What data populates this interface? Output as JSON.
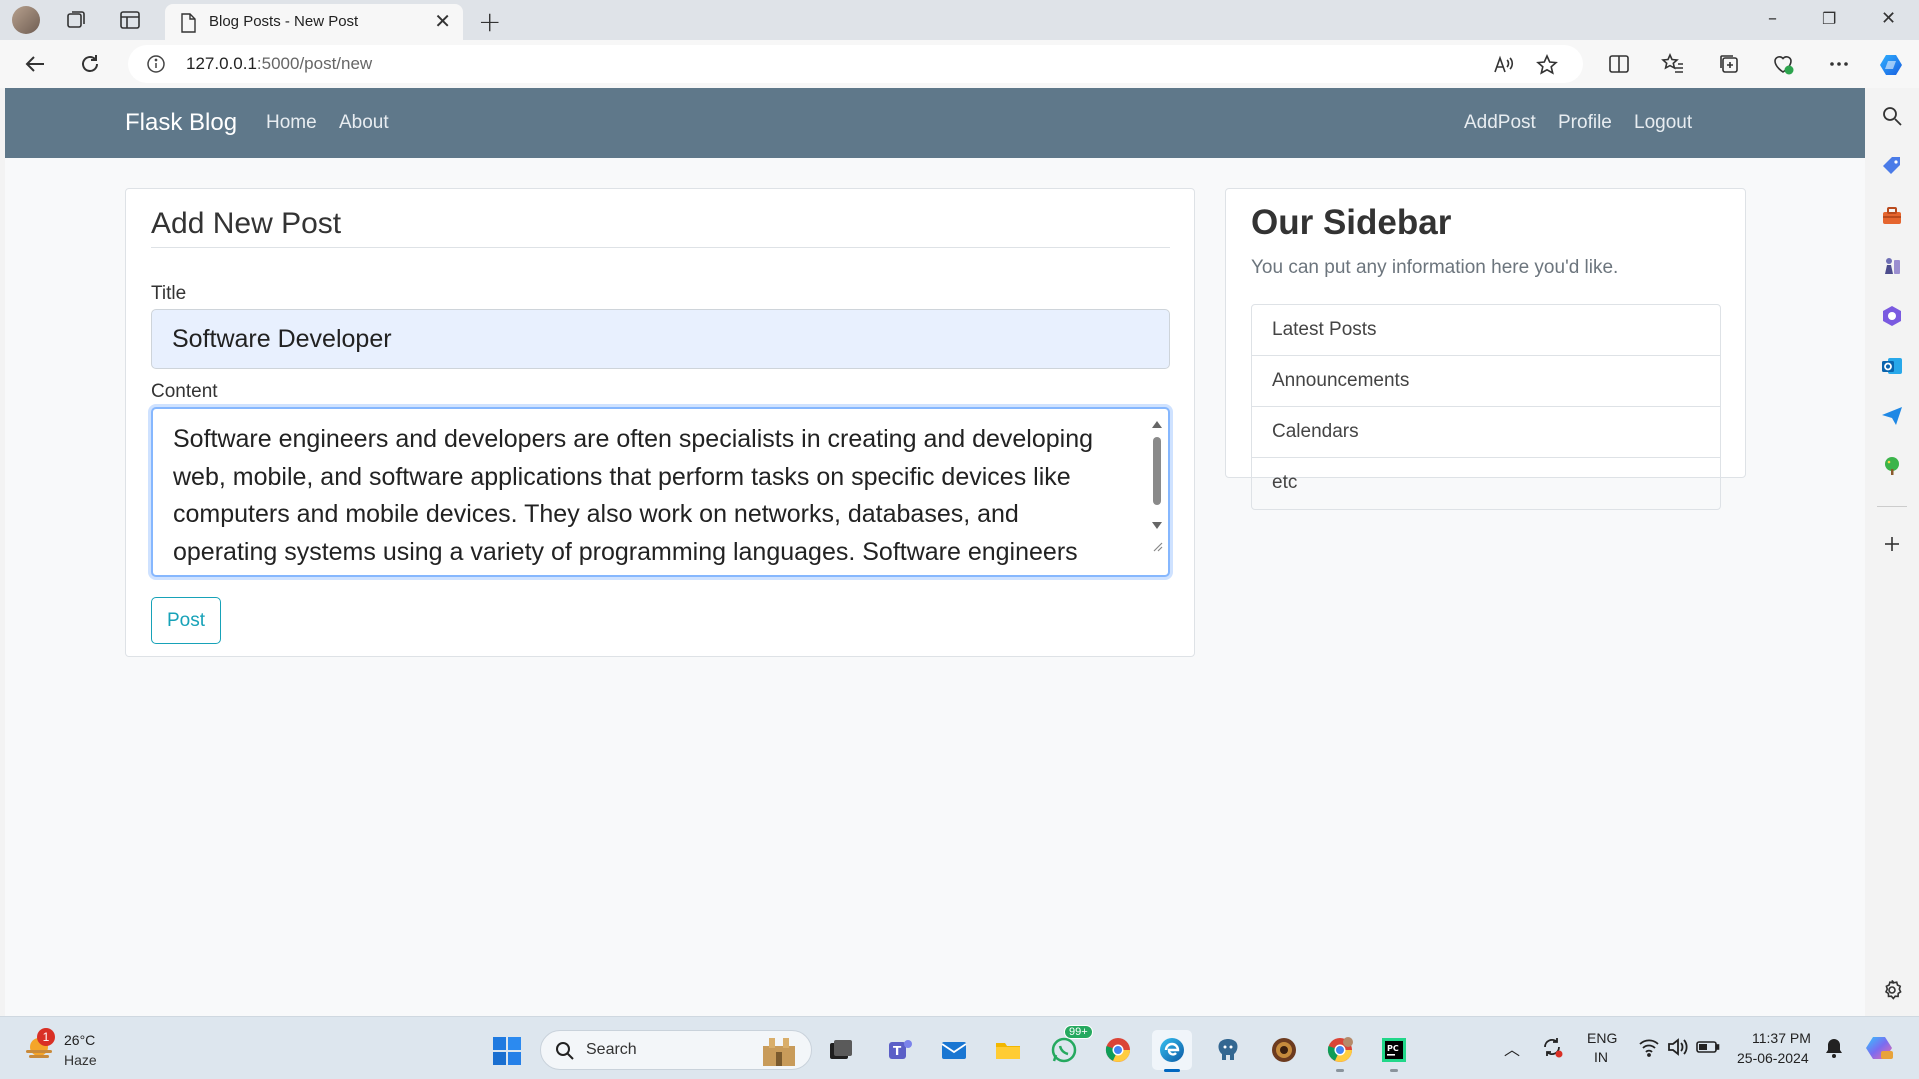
{
  "browser": {
    "tab_title": "Blog Posts - New Post",
    "url_host": "127.0.0.1",
    "url_path": ":5000/post/new"
  },
  "navbar": {
    "brand": "Flask Blog",
    "left_links": [
      "Home",
      "About"
    ],
    "right_links": [
      "AddPost",
      "Profile",
      "Logout"
    ]
  },
  "form": {
    "legend": "Add New Post",
    "title_label": "Title",
    "title_value": "Software Developer",
    "content_label": "Content",
    "content_value": "Software engineers and developers are often specialists in creating and developing web, mobile, and software applications that perform tasks on specific devices like computers and mobile devices. They also work on networks, databases, and operating systems using a variety of programming languages. Software engineers use",
    "submit_label": "Post"
  },
  "sidebar": {
    "title": "Our Sidebar",
    "text": "You can put any information here you'd like.",
    "items": [
      "Latest Posts",
      "Announcements",
      "Calendars",
      "etc"
    ]
  },
  "taskbar": {
    "weather_temp": "26°C",
    "weather_condition": "Haze",
    "weather_badge": "1",
    "search_label": "Search",
    "whatsapp_badge": "99+",
    "lang_top": "ENG",
    "lang_bottom": "IN",
    "time": "11:37 PM",
    "date": "25-06-2024"
  },
  "colors": {
    "navbar": "#5f788a",
    "post_button": "#17a2b8",
    "title_input_bg": "#e8f0fe"
  }
}
